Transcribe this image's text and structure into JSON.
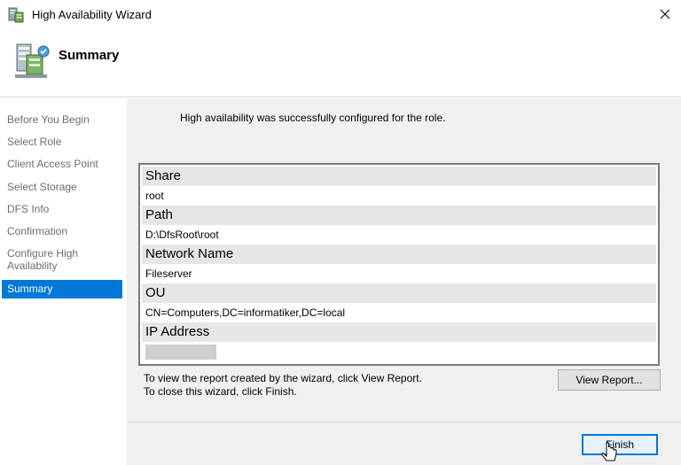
{
  "window": {
    "title": "High Availability Wizard",
    "close_glyph": "✕"
  },
  "header": {
    "title": "Summary",
    "icon": "server-wizard-icon"
  },
  "nav": {
    "items": [
      {
        "label": "Before You Begin"
      },
      {
        "label": "Select Role"
      },
      {
        "label": "Client Access Point"
      },
      {
        "label": "Select Storage"
      },
      {
        "label": "DFS Info"
      },
      {
        "label": "Confirmation"
      },
      {
        "label": "Configure High Availability"
      },
      {
        "label": "Summary",
        "active": true
      }
    ]
  },
  "main": {
    "message": "High availability was successfully configured for the role.",
    "report": {
      "sections": [
        {
          "header": "Share",
          "value": "root"
        },
        {
          "header": "Path",
          "value": "D:\\DfsRoot\\root"
        },
        {
          "header": "Network Name",
          "value": "Fileserver"
        },
        {
          "header": "OU",
          "value": "CN=Computers,DC=informatiker,DC=local"
        },
        {
          "header": "IP Address",
          "value": ""
        }
      ]
    },
    "info_line1": "To view the report created by the wizard, click View Report.",
    "info_line2": "To close this wizard, click Finish.",
    "view_report_label": "View Report...",
    "finish_label": "Finish"
  },
  "colors": {
    "accent": "#0078d7",
    "content_bg": "#f0f0f0"
  }
}
